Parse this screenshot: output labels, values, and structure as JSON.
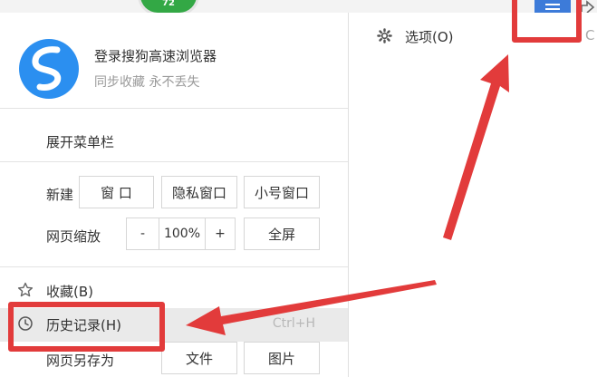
{
  "badge": {
    "text": "72"
  },
  "login": {
    "title": "登录搜狗高速浏览器",
    "subtitle": "同步收藏 永不丢失"
  },
  "menu": {
    "expand_menubar": "展开菜单栏",
    "new_label": "新建",
    "new_buttons": [
      "窗 口",
      "隐私窗口",
      "小号窗口"
    ],
    "zoom_label": "网页缩放",
    "zoom_minus": "-",
    "zoom_value": "100%",
    "zoom_plus": "+",
    "fullscreen": "全屏",
    "favorites": "收藏(B)",
    "history": "历史记录(H)",
    "history_shortcut": "Ctrl+H",
    "save_as_label": "网页另存为",
    "save_file": "文件",
    "save_image": "图片"
  },
  "right_panel": {
    "options": "选项(O)",
    "edge_text": "C"
  },
  "icons": {
    "logo": "sogou-browser-logo-icon",
    "favorites": "star-icon",
    "history": "clock-icon",
    "options": "gear-icon",
    "main_menu": "hamburger-menu-icon",
    "submenu": "chevron-right-icon",
    "share": "share-icon"
  },
  "colors": {
    "accent_blue": "#3d7bd9",
    "logo_blue": "#2b8ff0",
    "badge_green": "#33a845",
    "annotation_red": "#e23b3b",
    "hover_gray": "#eaeaea"
  }
}
